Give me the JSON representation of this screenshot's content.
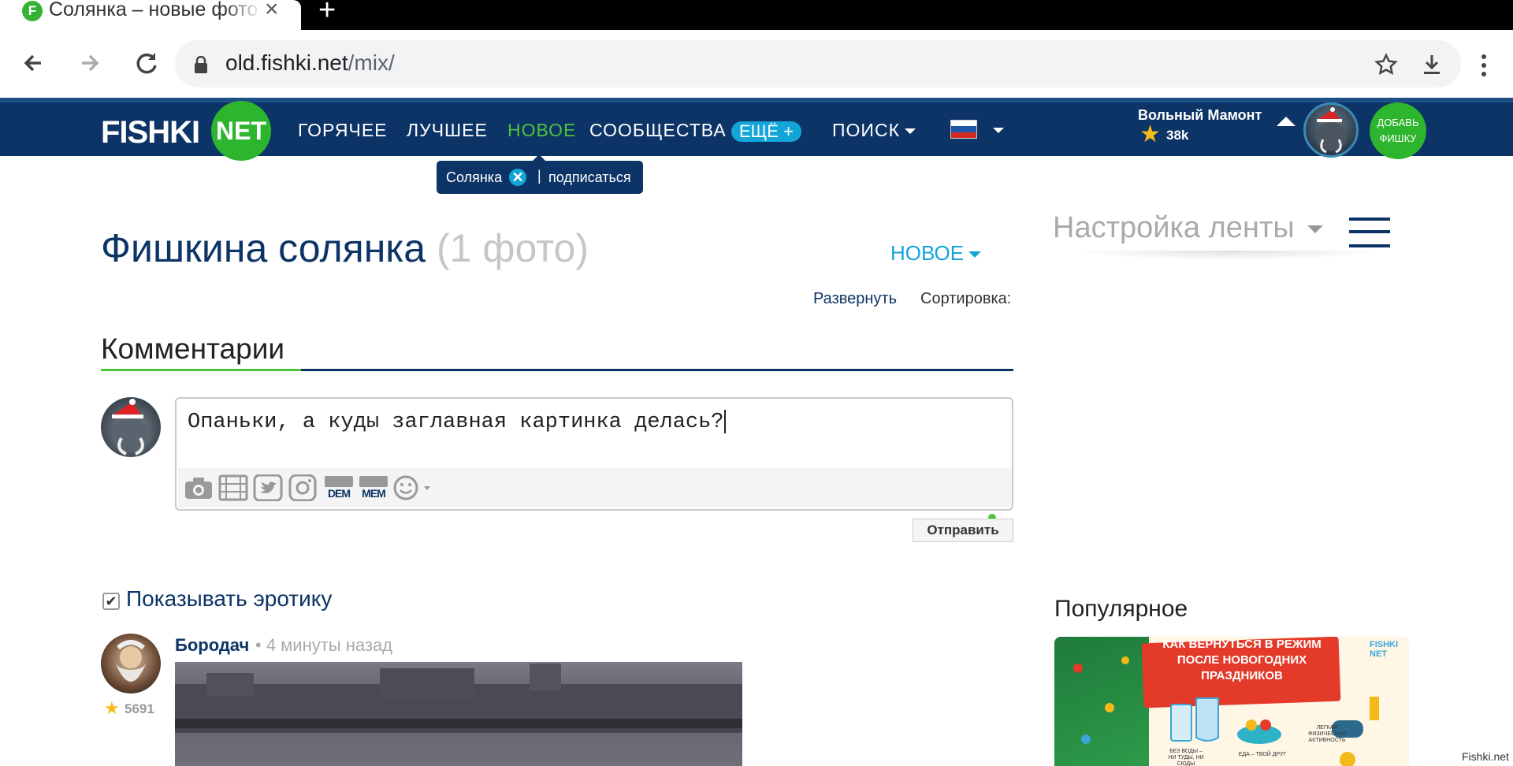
{
  "browser": {
    "tab_title": "Солянка – новые фото и картинки",
    "tab_favicon": "F",
    "url_domain": "old.fishki.net",
    "url_path": "/mix/",
    "icons": [
      "back-arrow-icon",
      "forward-arrow-icon",
      "reload-icon",
      "lock-icon",
      "star-icon",
      "download-icon",
      "menu-dots-icon"
    ]
  },
  "site": {
    "logo_text": "FISHKI",
    "logo_badge": "NET",
    "nav": {
      "hot": "ГОРЯЧЕЕ",
      "best": "ЛУЧШЕЕ",
      "new": "НОВОЕ",
      "communities": "СООБЩЕСТВА",
      "more": "ЕЩЁ +",
      "search": "ПОИСК"
    },
    "user": {
      "name": "Вольный Мамонт",
      "rating": "38k"
    },
    "add_button": [
      "ДОБАВЬ",
      "ФИШКУ"
    ],
    "colors": {
      "header": "#0d3466",
      "accent_green": "#4ec23a",
      "accent_blue": "#12a6d8"
    }
  },
  "tooltip": {
    "label": "Солянка",
    "close": "✕",
    "separator": "|",
    "subscribe": "подписаться"
  },
  "main": {
    "title": "Фишкина солянка",
    "count": "(1 фото)",
    "sort_value": "НОВОЕ",
    "expand": "Развернуть",
    "sort_label": "Сортировка:",
    "comments_title": "Комментарии",
    "comment_text": "Опаньки, а куды заглавная картинка делась?",
    "tools": [
      "camera-icon",
      "film-icon",
      "twitter-icon",
      "instagram-icon",
      "dem-icon",
      "mem-icon",
      "emoji-icon"
    ],
    "tool_dem": "DEM",
    "tool_mem": "MEM",
    "send_button": "Отправить",
    "show_erotic": "Показывать эротику",
    "show_erotic_checked": true,
    "post": {
      "author": "Бородач",
      "time": "• 4 минуты назад",
      "rating": "5691"
    }
  },
  "sidebar": {
    "feed_settings": "Настройка ленты",
    "popular_title": "Популярное",
    "popular_image_text": "КАК ВЕРНУТЬСЯ В РЕЖИМ ПОСЛЕ НОВОГОДНИХ ПРАЗДНИКОВ",
    "popular_logo": "FISHKI NET",
    "popular_captions": [
      "БЕЗ ВОДЫ – НИ ТУДЫ, НИ СЮДЫ",
      "ЕДА – ТВОЙ ДРУГ",
      "ЛЕГКАЯ ФИЗИЧЕСКАЯ АКТИВНОСТЬ"
    ]
  },
  "watermark": "Fishki.net"
}
